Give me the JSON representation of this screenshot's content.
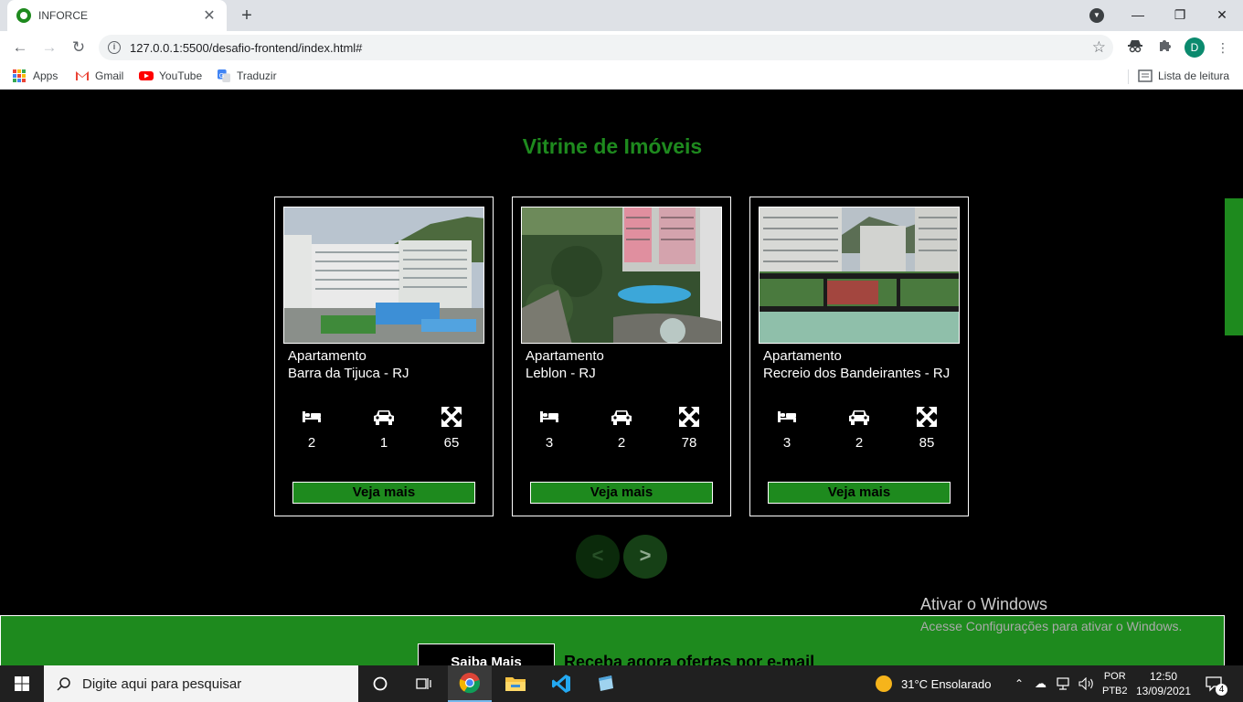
{
  "browser": {
    "tab_title": "INFORCE",
    "url": "127.0.0.1:5500/desafio-frontend/index.html#",
    "profile_initial": "D",
    "bookmarks": [
      "Apps",
      "Gmail",
      "YouTube",
      "Traduzir"
    ],
    "reading_list": "Lista de leitura"
  },
  "page": {
    "title": "Vitrine de Imóveis",
    "cards": [
      {
        "type": "Apartamento",
        "location": "Barra da Tijuca  - RJ",
        "beds": "2",
        "cars": "1",
        "area": "65",
        "button": "Veja mais"
      },
      {
        "type": "Apartamento",
        "location": "Leblon  - RJ",
        "beds": "3",
        "cars": "2",
        "area": "78",
        "button": "Veja mais"
      },
      {
        "type": "Apartamento",
        "location": "Recreio dos Bandeirantes  - RJ",
        "beds": "3",
        "cars": "2",
        "area": "85",
        "button": "Veja mais"
      }
    ],
    "pager_prev": "<",
    "pager_next": ">",
    "footer_button": "Saiba Mais",
    "footer_text": "Receba agora ofertas por e-mail"
  },
  "watermark": {
    "title": "Ativar o Windows",
    "subtitle": "Acesse Configurações para ativar o Windows."
  },
  "taskbar": {
    "search_placeholder": "Digite aqui para pesquisar",
    "weather": "31°C  Ensolarado",
    "lang_top": "POR",
    "lang_bottom": "PTB2",
    "time": "12:50",
    "date": "13/09/2021",
    "notifications": "4"
  },
  "colors": {
    "accent": "#1e8a1e",
    "background": "#000000"
  }
}
